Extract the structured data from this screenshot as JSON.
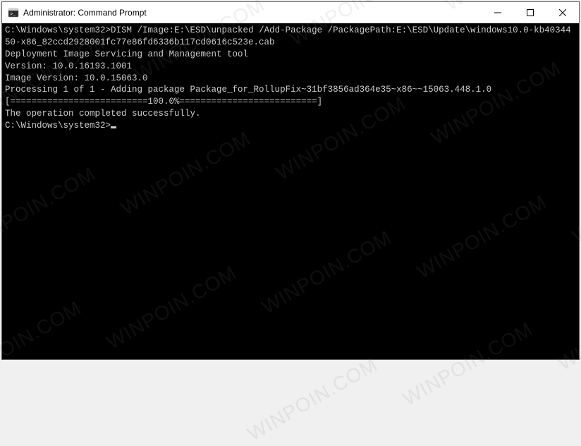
{
  "titlebar": {
    "title": "Administrator: Command Prompt",
    "minimize_glyph": "—",
    "maximize_glyph": "☐",
    "close_glyph": "✕"
  },
  "console": {
    "prompt1_path": "C:\\Windows\\system32>",
    "command1": "DISM /Image:E:\\ESD\\unpacked /Add-Package /PackagePath:E:\\ESD\\Update\\windows10.0-kb4034450-x86_82ccd2928001fc77e86fd6336b117cd0616c523e.cab",
    "blank1": "",
    "tool_name": "Deployment Image Servicing and Management tool",
    "tool_version": "Version: 10.0.16193.1001",
    "blank2": "",
    "image_version": "Image Version: 10.0.15063.0",
    "blank3": "",
    "processing": "Processing 1 of 1 - Adding package Package_for_RollupFix~31bf3856ad364e35~x86~~15063.448.1.0",
    "progress": "[==========================100.0%==========================]",
    "completed": "The operation completed successfully.",
    "blank4": "",
    "prompt2_path": "C:\\Windows\\system32>"
  },
  "watermark": {
    "text": "WINPOIN.COM"
  }
}
